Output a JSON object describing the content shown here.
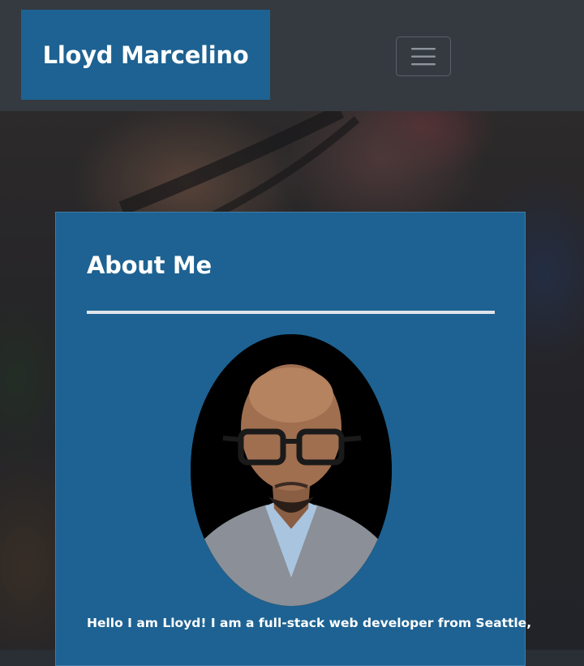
{
  "navbar": {
    "brand": "Lloyd Marcelino",
    "menu_toggle_icon": "hamburger-menu-icon"
  },
  "about": {
    "title": "About Me",
    "intro": "Hello I am Lloyd! I am a full-stack web developer from Seattle,"
  },
  "colors": {
    "navbar_bg": "#343a40",
    "brand_bg": "#1d6292",
    "card_bg": "#1d6292",
    "text": "#ffffff"
  }
}
